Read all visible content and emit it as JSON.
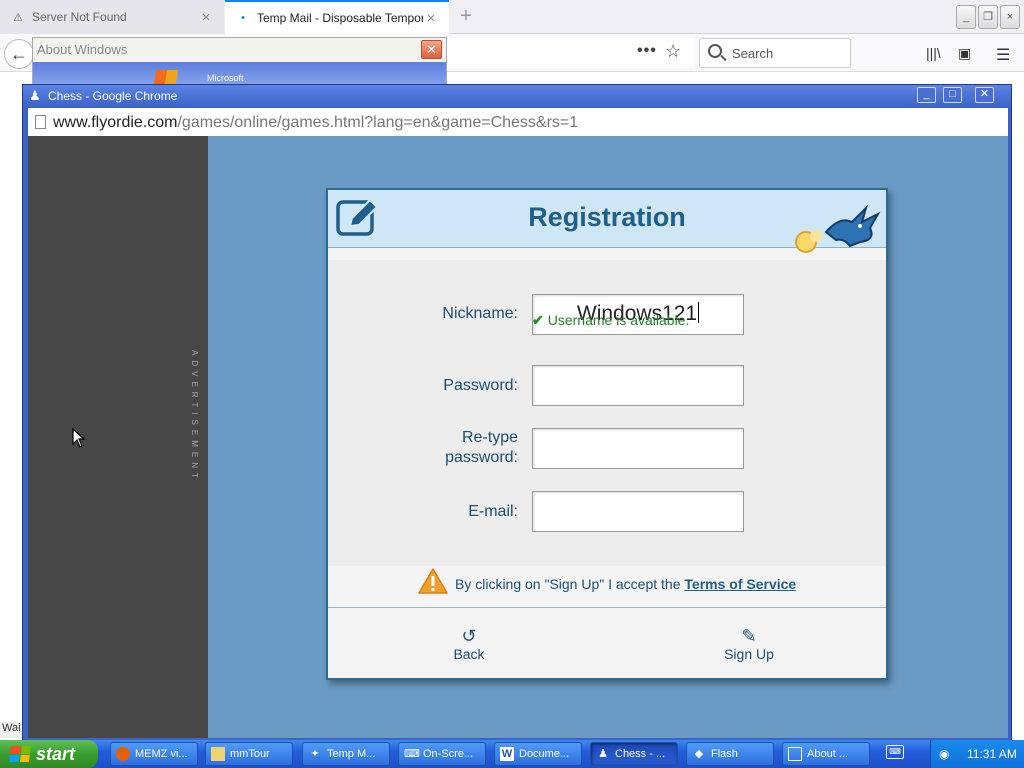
{
  "firefox": {
    "tabs": [
      {
        "label": "Server Not Found"
      },
      {
        "label": "Temp Mail - Disposable Temporary E"
      }
    ],
    "search_placeholder": "Search",
    "status_text": "Wai"
  },
  "about_dialog": {
    "title": "About Windows",
    "brand": "Microsoft"
  },
  "chrome": {
    "title": "Chess - Google Chrome",
    "url_host": "www.flyordie.com",
    "url_path": "/games/online/games.html?lang=en&game=Chess&rs=1",
    "ad_label": "ADVERTISEMENT"
  },
  "registration": {
    "title": "Registration",
    "fields": [
      {
        "label": "Nickname:",
        "value": "Windows121"
      },
      {
        "label": "Password:",
        "value": ""
      },
      {
        "label_line1": "Re-type",
        "label_line2": "password:",
        "value": ""
      },
      {
        "label": "E-mail:",
        "value": ""
      }
    ],
    "availability": "Username is available.",
    "tos_prefix": "By clicking on \"Sign Up\" I accept the ",
    "tos_link": "Terms of Service",
    "back_label": "Back",
    "signup_label": "Sign Up"
  },
  "taskbar": {
    "start_label": "start",
    "items": [
      {
        "label": "MEMZ vi..."
      },
      {
        "label": "mmTour"
      },
      {
        "label": "Temp M..."
      },
      {
        "label": "On-Scre..."
      },
      {
        "label": "Docume..."
      },
      {
        "label": "Chess - ..."
      },
      {
        "label": "Flash"
      },
      {
        "label": "About ..."
      }
    ],
    "clock": "11:31 AM"
  },
  "colors": {
    "header_text": "#1f5f8a",
    "available_green": "#2a7a2a",
    "xp_taskbar": "#245edb"
  }
}
